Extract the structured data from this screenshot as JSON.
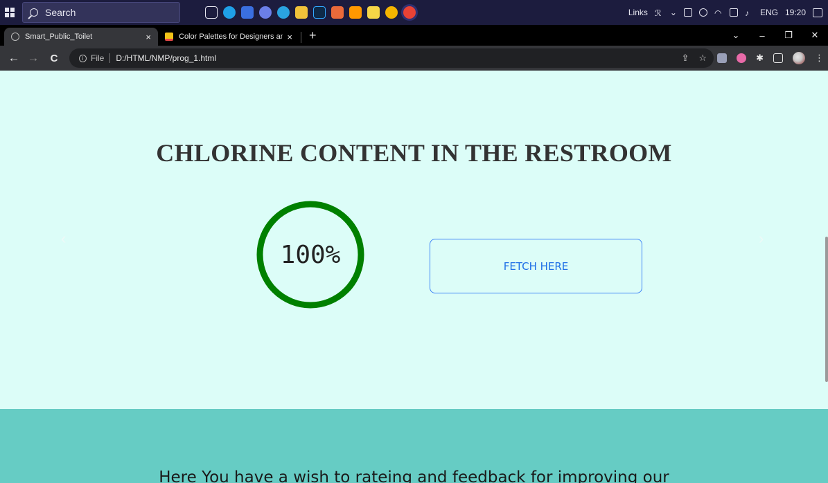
{
  "taskbar": {
    "search_placeholder": "Search",
    "tray_links": "Links",
    "language": "ENG",
    "clock": "19:20"
  },
  "tabs": [
    {
      "title": "Smart_Public_Toilet",
      "close": "×"
    },
    {
      "title": "Color Palettes for Designers and",
      "close": "×"
    }
  ],
  "new_tab": "+",
  "window_controls": {
    "minimize": "–",
    "restore": "❐",
    "close": "✕",
    "dropdown": "⌄"
  },
  "nav": {
    "back": "←",
    "forward": "→",
    "reload": "C"
  },
  "address": {
    "scheme_label": "File",
    "url": "D:/HTML/NMP/prog_1.html"
  },
  "omnibox_actions": {
    "share": "⇪",
    "bookmark": "☆"
  },
  "menu": "⋮",
  "hero": {
    "title": "CHLORINE CONTENT IN THE RESTROOM",
    "gauge_value": "100%",
    "gauge_fraction": 1.0,
    "gauge_color": "#008000",
    "fetch_label": "FETCH HERE",
    "prev": "‹",
    "next": "›"
  },
  "feedback": {
    "text": "Here You have a wish to rateing and feedback for improving our"
  },
  "colors": {
    "page_bg": "#dcfdf8",
    "feedback_bg": "#66ccc4",
    "button_border": "#3b82f6",
    "button_text": "#1e6fe6"
  }
}
